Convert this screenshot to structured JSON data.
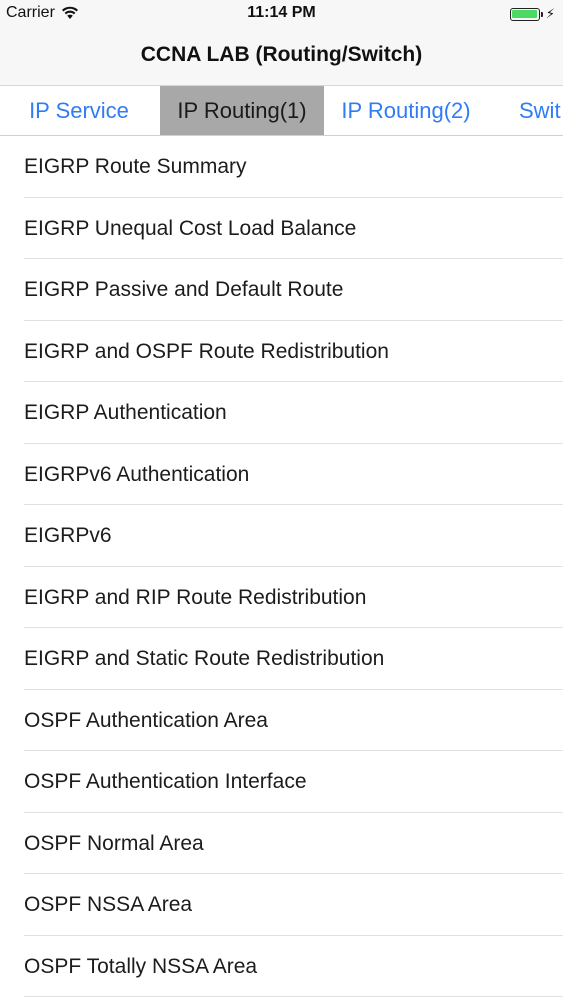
{
  "status_bar": {
    "carrier": "Carrier",
    "time": "11:14 PM",
    "battery_level": 1.0,
    "wifi_icon": "wifi-icon",
    "charge_icon": "charging-bolt-icon"
  },
  "nav": {
    "title": "CCNA LAB (Routing/Switch)"
  },
  "tabs": [
    {
      "label": "IP Service",
      "active": false
    },
    {
      "label": "IP Routing(1)",
      "active": true
    },
    {
      "label": "IP Routing(2)",
      "active": false
    },
    {
      "label": "Swit",
      "active": false
    }
  ],
  "colors": {
    "accent": "#2f7cf6",
    "active_tab_bg": "#a8a8a8",
    "battery": "#4cd964"
  },
  "list": {
    "items": [
      "EIGRP Route Summary",
      "EIGRP Unequal Cost Load Balance",
      "EIGRP Passive and Default Route",
      "EIGRP and OSPF Route Redistribution",
      "EIGRP Authentication",
      "EIGRPv6 Authentication",
      "EIGRPv6",
      "EIGRP and RIP Route Redistribution",
      "EIGRP and Static Route Redistribution",
      "OSPF Authentication Area",
      "OSPF Authentication Interface",
      "OSPF Normal Area",
      "OSPF NSSA Area",
      "OSPF Totally NSSA Area"
    ]
  }
}
